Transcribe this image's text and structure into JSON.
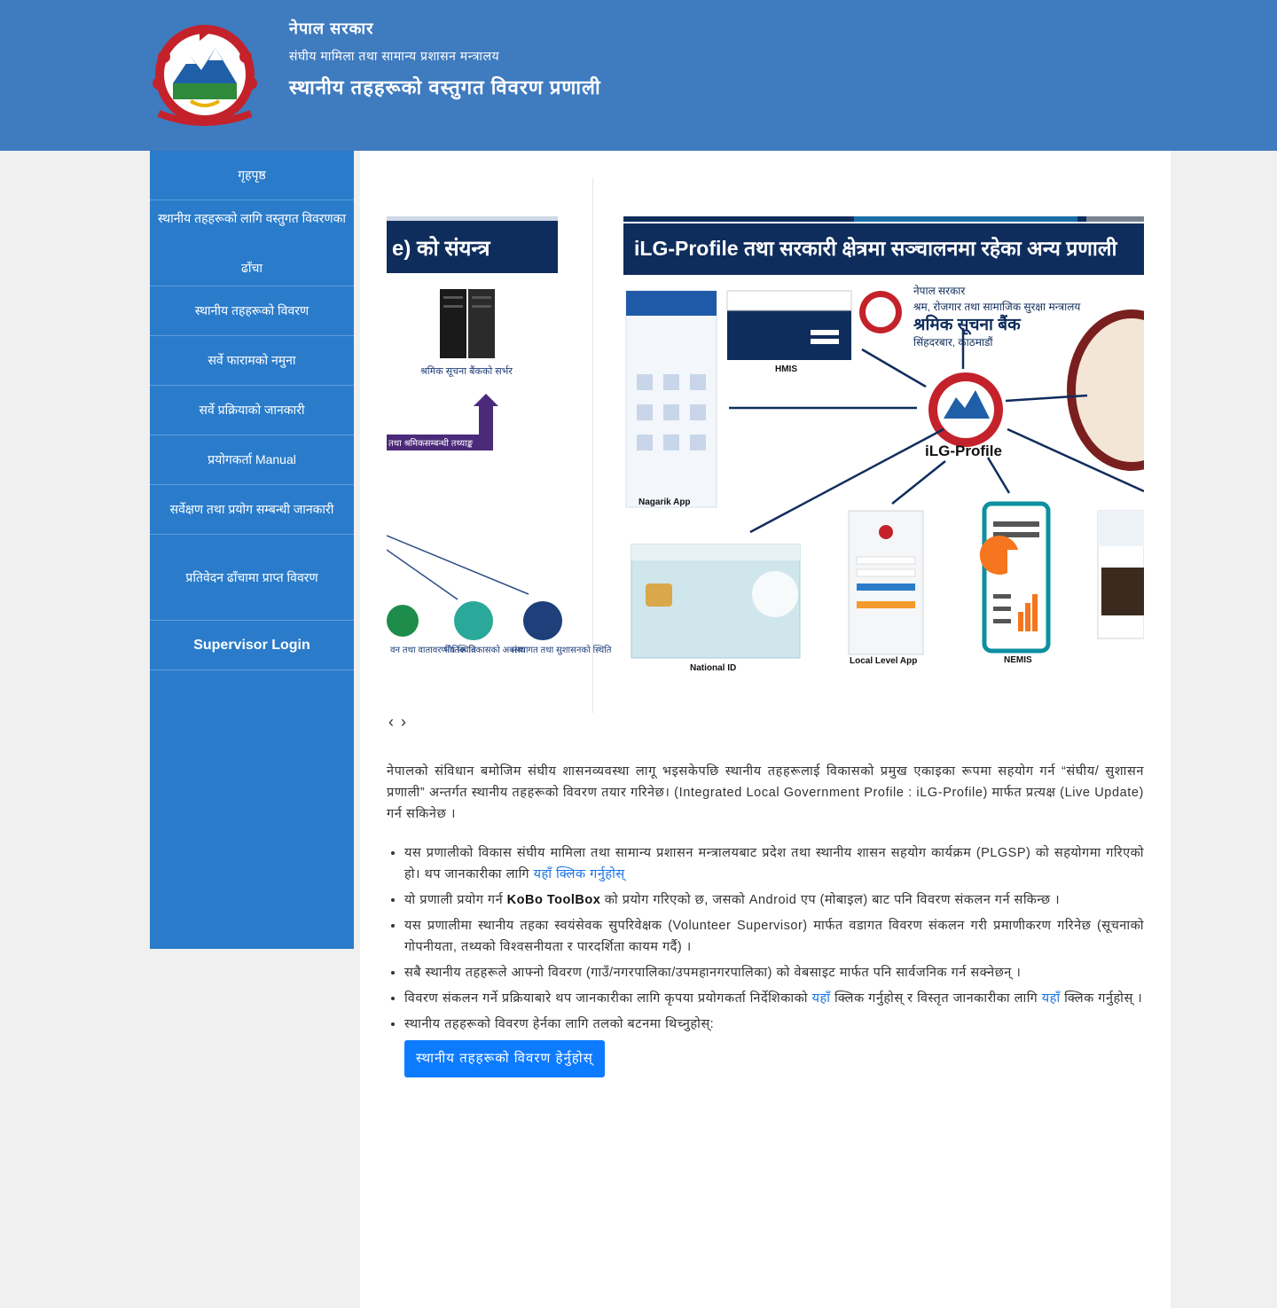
{
  "header": {
    "line1": "नेपाल सरकार",
    "line2": "संघीय मामिला तथा सामान्य प्रशासन मन्त्रालय",
    "line3": "स्थानीय तहहरूको वस्तुगत विवरण प्रणाली"
  },
  "sidebar": {
    "items": [
      "गृहपृष्ठ",
      "स्थानीय तहहरूको लागि वस्तुगत विवरणका ढाँचा",
      "स्थानीय तहहरूको विवरण",
      "सर्वे फारामको नमुना",
      "सर्वे प्रक्रियाको जानकारी",
      "प्रयोगकर्ता Manual",
      "सर्वेक्षण तथा प्रयोग सम्बन्धी जानकारी",
      "प्रतिवेदन ढाँचामा प्राप्त विवरण",
      "Supervisor Login"
    ]
  },
  "slider": {
    "left_title": "e) को संयन्त्र",
    "left_server": "श्रमिक सूचना बैंकको सर्भर",
    "left_arrow": "तथा श्रमिकसम्बन्धी तथ्याङ्क",
    "left_icons": [
      "वन तथा वातावरणीय स्थिति",
      "भौतिक विकासको अवस्था",
      "संस्थागत तथा सुशासनको स्थिति"
    ],
    "right_title": "iLG-Profile तथा सरकारी क्षेत्रमा सञ्चालनमा रहेका अन्य प्रणाली",
    "bank_line1": "नेपाल सरकार",
    "bank_line2": "श्रम, रोजगार तथा सामाजिक सुरक्षा मन्त्रालय",
    "bank_line3": "श्रमिक सूचना बैंक",
    "bank_line4": "सिंहदरबार, काठमाडौं",
    "center_label": "iLG-Profile",
    "nodes": [
      "HMIS",
      "Nagarik App",
      "National ID",
      "Local Level App",
      "NEMIS"
    ]
  },
  "nav": {
    "prev": "‹",
    "next": "›"
  },
  "content": {
    "intro": "नेपालको संविधान बमोजिम संघीय शासनव्यवस्था लागू भइसकेपछि स्थानीय तहहरूलाई विकासको प्रमुख एकाइका रूपमा सहयोग गर्न “संघीय/ सुशासन प्रणाली” अन्तर्गत स्थानीय तहहरूको विवरण तयार गरिनेछ। (Integrated Local Government Profile : iLG-Profile) मार्फत प्रत्यक्ष (Live Update) गर्न सकिनेछ ।",
    "bullets": [
      {
        "text": "यस प्रणालीको विकास संघीय मामिला तथा सामान्य प्रशासन मन्त्रालयबाट प्रदेश तथा स्थानीय शासन सहयोग कार्यक्रम (PLGSP) को सहयोगमा गरिएको हो। थप जानकारीका लागि ",
        "link": "यहाँ क्लिक गर्नुहोस्"
      },
      {
        "text_a": "यो प्रणाली प्रयोग गर्न ",
        "bold": "KoBo ToolBox",
        "text_b": " को प्रयोग गरिएको छ, जसको Android एप (मोबाइल) बाट पनि विवरण संकलन गर्न सकिन्छ ।"
      },
      {
        "text": "यस प्रणालीमा स्थानीय तहका स्वयंसेवक सुपरिवेक्षक (Volunteer Supervisor) मार्फत वडागत विवरण संकलन गरी प्रमाणीकरण गरिनेछ (सूचनाको गोपनीयता, तथ्यको विश्वसनीयता र पारदर्शिता कायम गर्दै) ।"
      },
      {
        "text": "सबै स्थानीय तहहरूले आफ्नो विवरण (गाउँ/नगरपालिका/उपमहानगरपालिका) को वेबसाइट मार्फत पनि सार्वजनिक गर्न सक्नेछन् ।"
      },
      {
        "text_a": "विवरण संकलन गर्ने प्रक्रियाबारे थप जानकारीका लागि कृपया प्रयोगकर्ता निर्देशिकाको ",
        "link_a": "यहाँ",
        "text_b": " क्लिक गर्नुहोस् र विस्तृत जानकारीका लागि ",
        "link_b": "यहाँ",
        "text_c": " क्लिक गर्नुहोस् ।"
      },
      {
        "text": "स्थानीय तहहरूको विवरण हेर्नका लागि तलको बटनमा थिच्नुहोस्:"
      }
    ],
    "cta_label": "स्थानीय तहहरूको विवरण हेर्नुहोस्"
  },
  "colors": {
    "header": "#3f7bbf",
    "sidebar": "#2a7ccb",
    "cta": "#0d7bff",
    "link": "#1a73e8"
  }
}
